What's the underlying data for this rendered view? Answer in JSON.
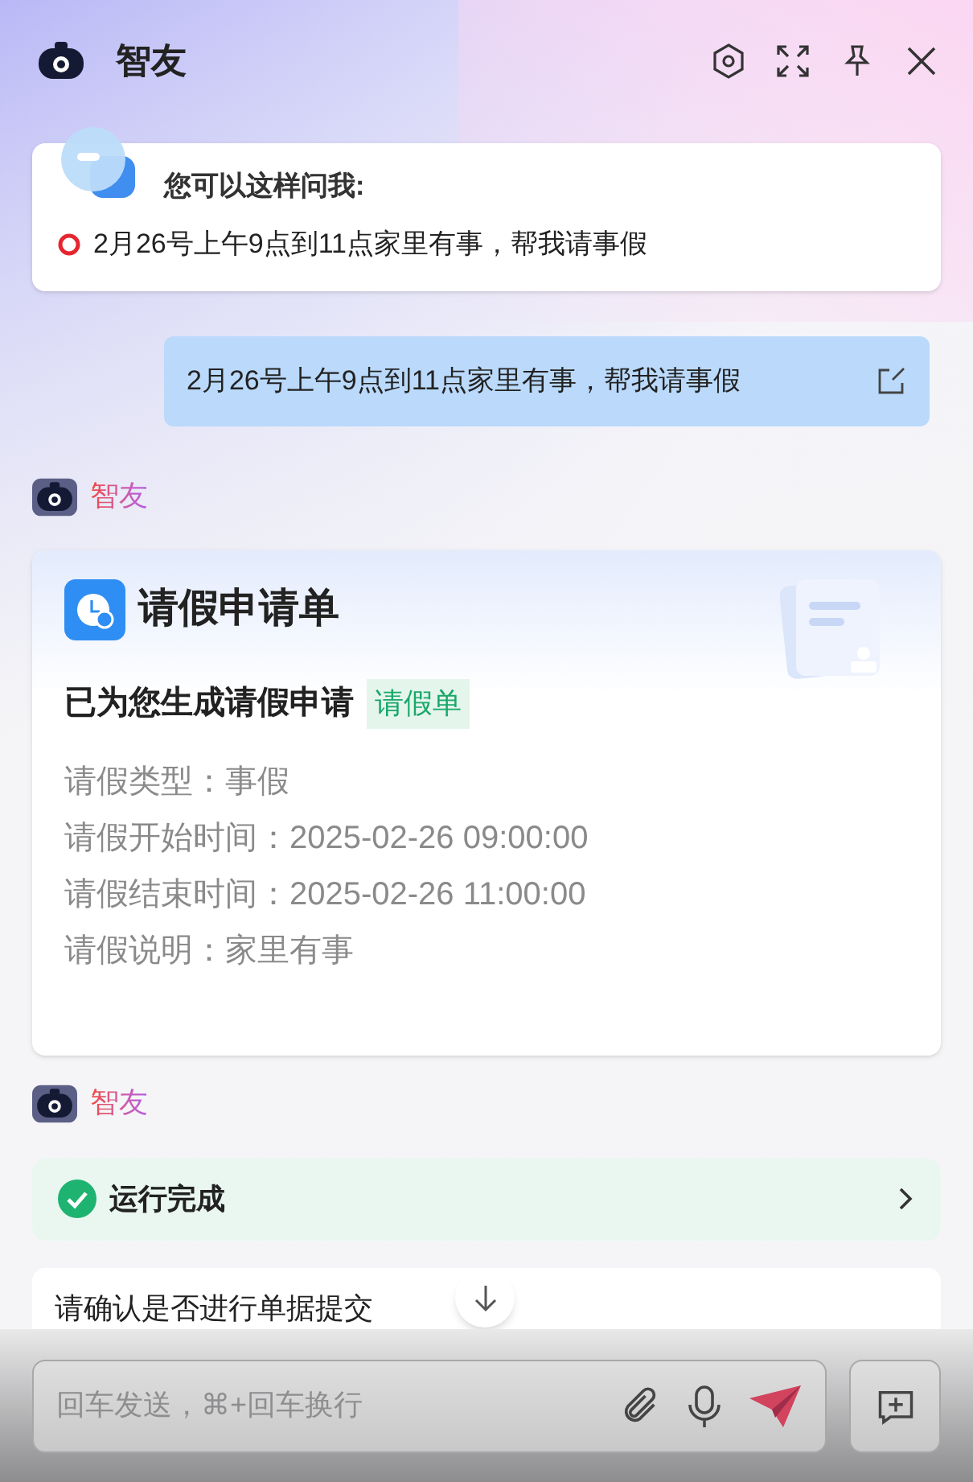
{
  "header": {
    "title": "智友"
  },
  "suggestions": {
    "title": "您可以这样问我:",
    "items": [
      "2月26号上午9点到11点家里有事，帮我请事假"
    ]
  },
  "user_message": {
    "text": "2月26号上午9点到11点家里有事，帮我请事假"
  },
  "bot_reply": {
    "name": "智友",
    "card": {
      "title": "请假申请单",
      "summary": "已为您生成请假申请",
      "tag": "请假单",
      "fields": [
        {
          "label": "请假类型：",
          "value": "事假"
        },
        {
          "label": "请假开始时间：",
          "value": "2025-02-26 09:00:00"
        },
        {
          "label": "请假结束时间：",
          "value": "2025-02-26 11:00:00"
        },
        {
          "label": "请假说明：",
          "value": "家里有事"
        }
      ]
    }
  },
  "bot_reply_2": {
    "name": "智友",
    "status": {
      "label": "运行完成",
      "kind": "done"
    },
    "message": "请确认是否进行单据提交"
  },
  "composer": {
    "placeholder": "回车发送，⌘+回车换行"
  }
}
